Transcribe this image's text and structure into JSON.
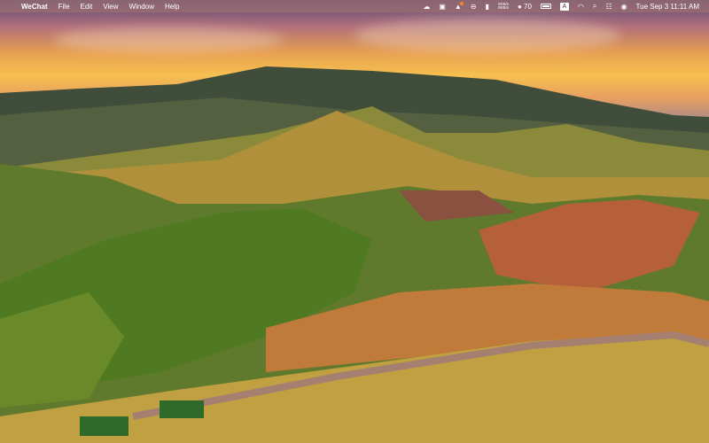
{
  "menubar": {
    "apple_icon": "apple-icon",
    "app_name": "WeChat",
    "menus": [
      "File",
      "Edit",
      "View",
      "Window",
      "Help"
    ],
    "status": {
      "net_up": "0KB/s",
      "net_down": "0KB/s",
      "wechat_count": "70",
      "input_source": "A",
      "clock": "Tue Sep 3  11:11 AM"
    }
  },
  "colors": {
    "notification_dot": "#f28c1e"
  }
}
